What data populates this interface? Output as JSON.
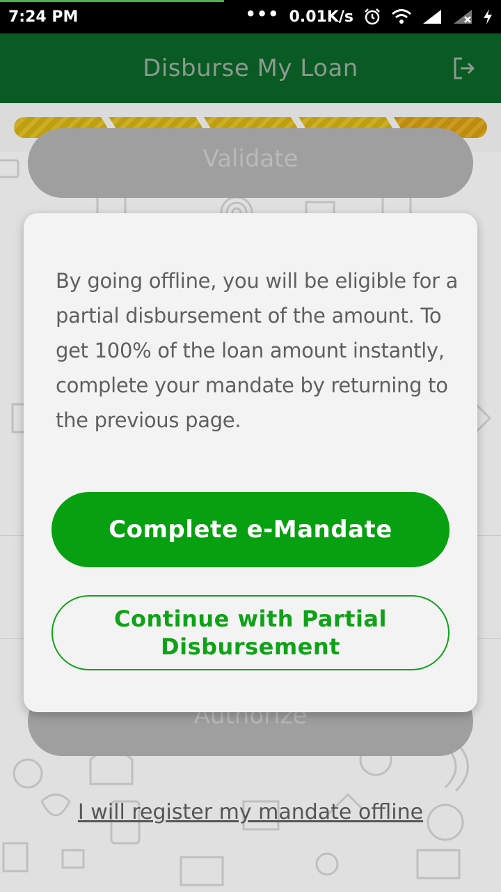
{
  "status_bar": {
    "time": "7:24 PM",
    "more": "•••",
    "network_speed": "0.01K/s",
    "icons": [
      "alarm-icon",
      "wifi-icon",
      "signal-icon",
      "signal-no-service-icon",
      "charging-icon"
    ]
  },
  "app_bar": {
    "title": "Disburse My Loan",
    "logout_icon": "logout-icon"
  },
  "stepper": {
    "steps": 5
  },
  "background": {
    "validate_label": "Validate",
    "authorize_label": "Authorize",
    "offline_link": "I will register my mandate offline"
  },
  "dialog": {
    "message": "By going offline, you will be eligible for a partial disbursement of the amount. To get 100% of the loan amount instantly, complete your mandate by returning to the previous page.",
    "primary_button": "Complete e-Mandate",
    "secondary_button": "Continue with Partial Disbursement"
  },
  "colors": {
    "app_bar": "#0a5a24",
    "primary": "#07a010",
    "stepper": "#d9b927"
  }
}
